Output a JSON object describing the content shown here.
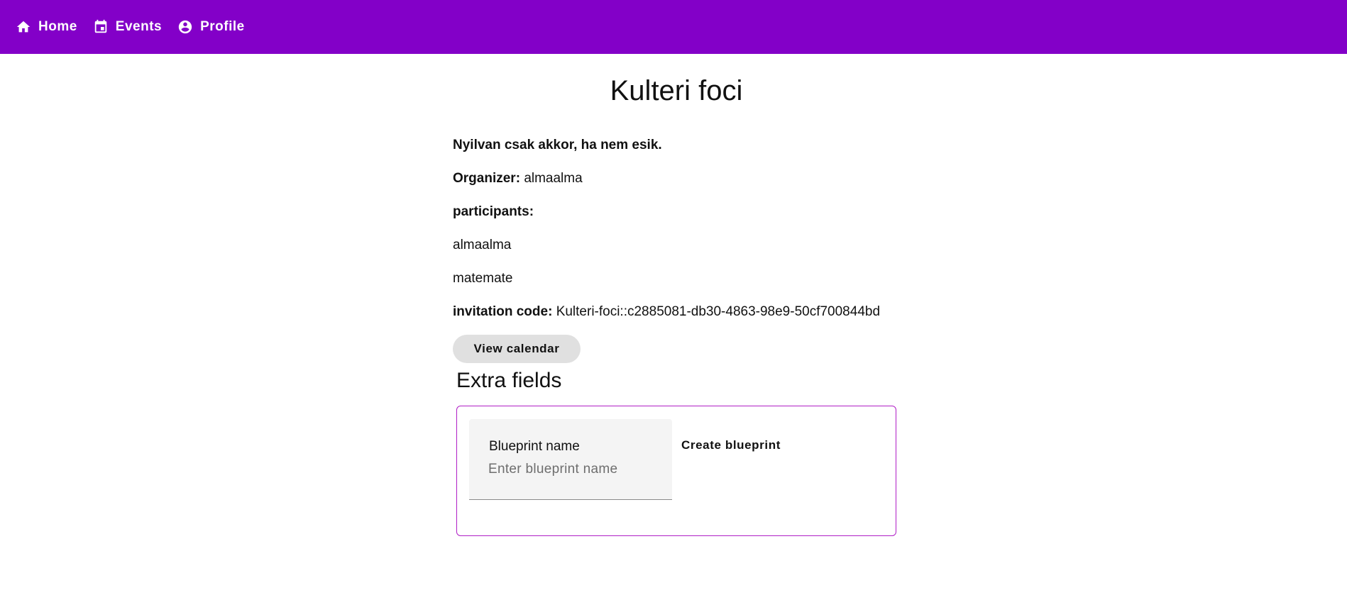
{
  "nav": {
    "items": [
      {
        "label": "Home",
        "icon": "home-icon"
      },
      {
        "label": "Events",
        "icon": "calendar-icon"
      },
      {
        "label": "Profile",
        "icon": "account-circle-icon"
      }
    ],
    "background": "#8300c8"
  },
  "event": {
    "title": "Kulteri foci",
    "description": "Nyilvan csak akkor, ha nem esik.",
    "organizer_label": "Organizer:",
    "organizer": "almaalma",
    "participants_label": "participants:",
    "participants": [
      "almaalma",
      "matemate"
    ],
    "invitation_label": "invitation code:",
    "invitation_code": "Kulteri-foci::c2885081-db30-4863-98e9-50cf700844bd",
    "view_calendar_label": "View calendar"
  },
  "extra_fields": {
    "title": "Extra fields",
    "border_color": "#b01ec6",
    "blueprint_label": "Blueprint name",
    "blueprint_placeholder": "Enter blueprint name",
    "blueprint_value": "",
    "create_label": "Create blueprint"
  }
}
